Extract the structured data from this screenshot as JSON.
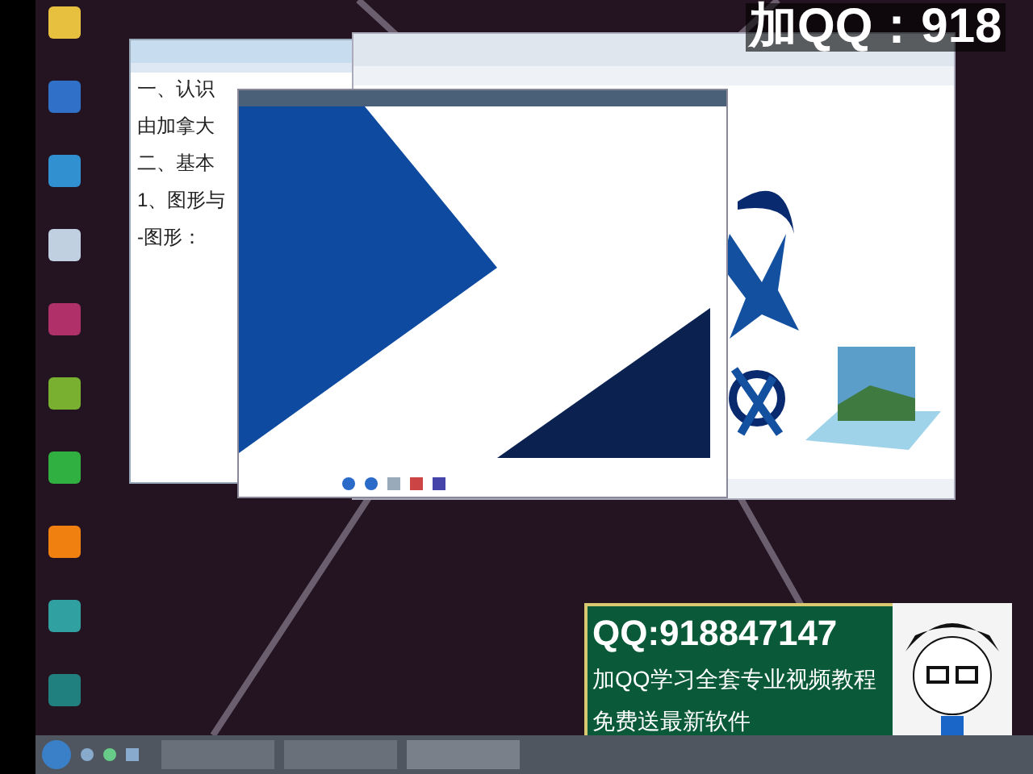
{
  "overlay_caption": "加QQ：918",
  "notepad": {
    "lines": [
      "一、认识",
      "由加拿大",
      "二、基本",
      "1、图形与",
      "-图形："
    ]
  },
  "promo_banner": {
    "lines": [
      "QQ:918847147",
      "加QQ学习全套专业视频教程",
      "免费送最新软件"
    ]
  }
}
